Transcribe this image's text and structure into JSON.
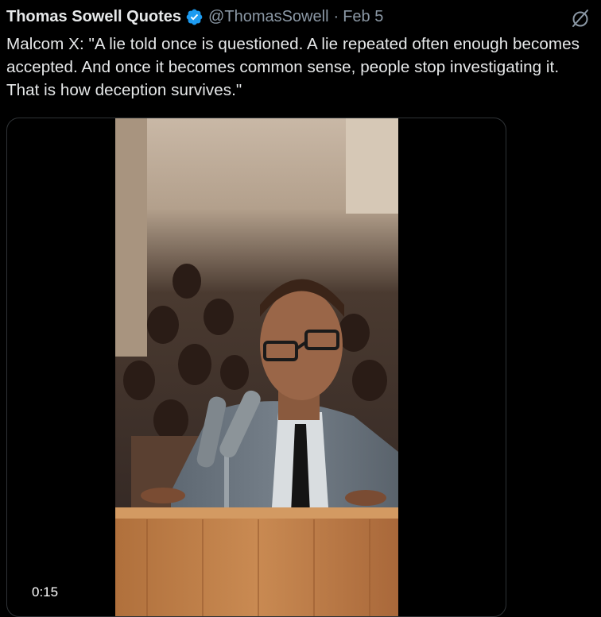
{
  "tweet": {
    "author_name": "Thomas Sowell Quotes",
    "handle": "@ThomasSowell",
    "separator": "·",
    "date": "Feb 5",
    "text": "Malcom X: \"A lie told once is questioned. A lie repeated often enough becomes accepted. And once it becomes common sense,  people stop investigating it. That is how deception survives.\""
  },
  "media": {
    "type": "video",
    "timestamp": "0:15"
  },
  "icons": {
    "verified": "verified-badge-icon",
    "grok": "grok-icon"
  },
  "colors": {
    "background": "#000000",
    "text_primary": "#e7e9ea",
    "text_secondary": "#8b98a5",
    "verified_blue": "#1d9bf0",
    "border": "#2f3336"
  }
}
